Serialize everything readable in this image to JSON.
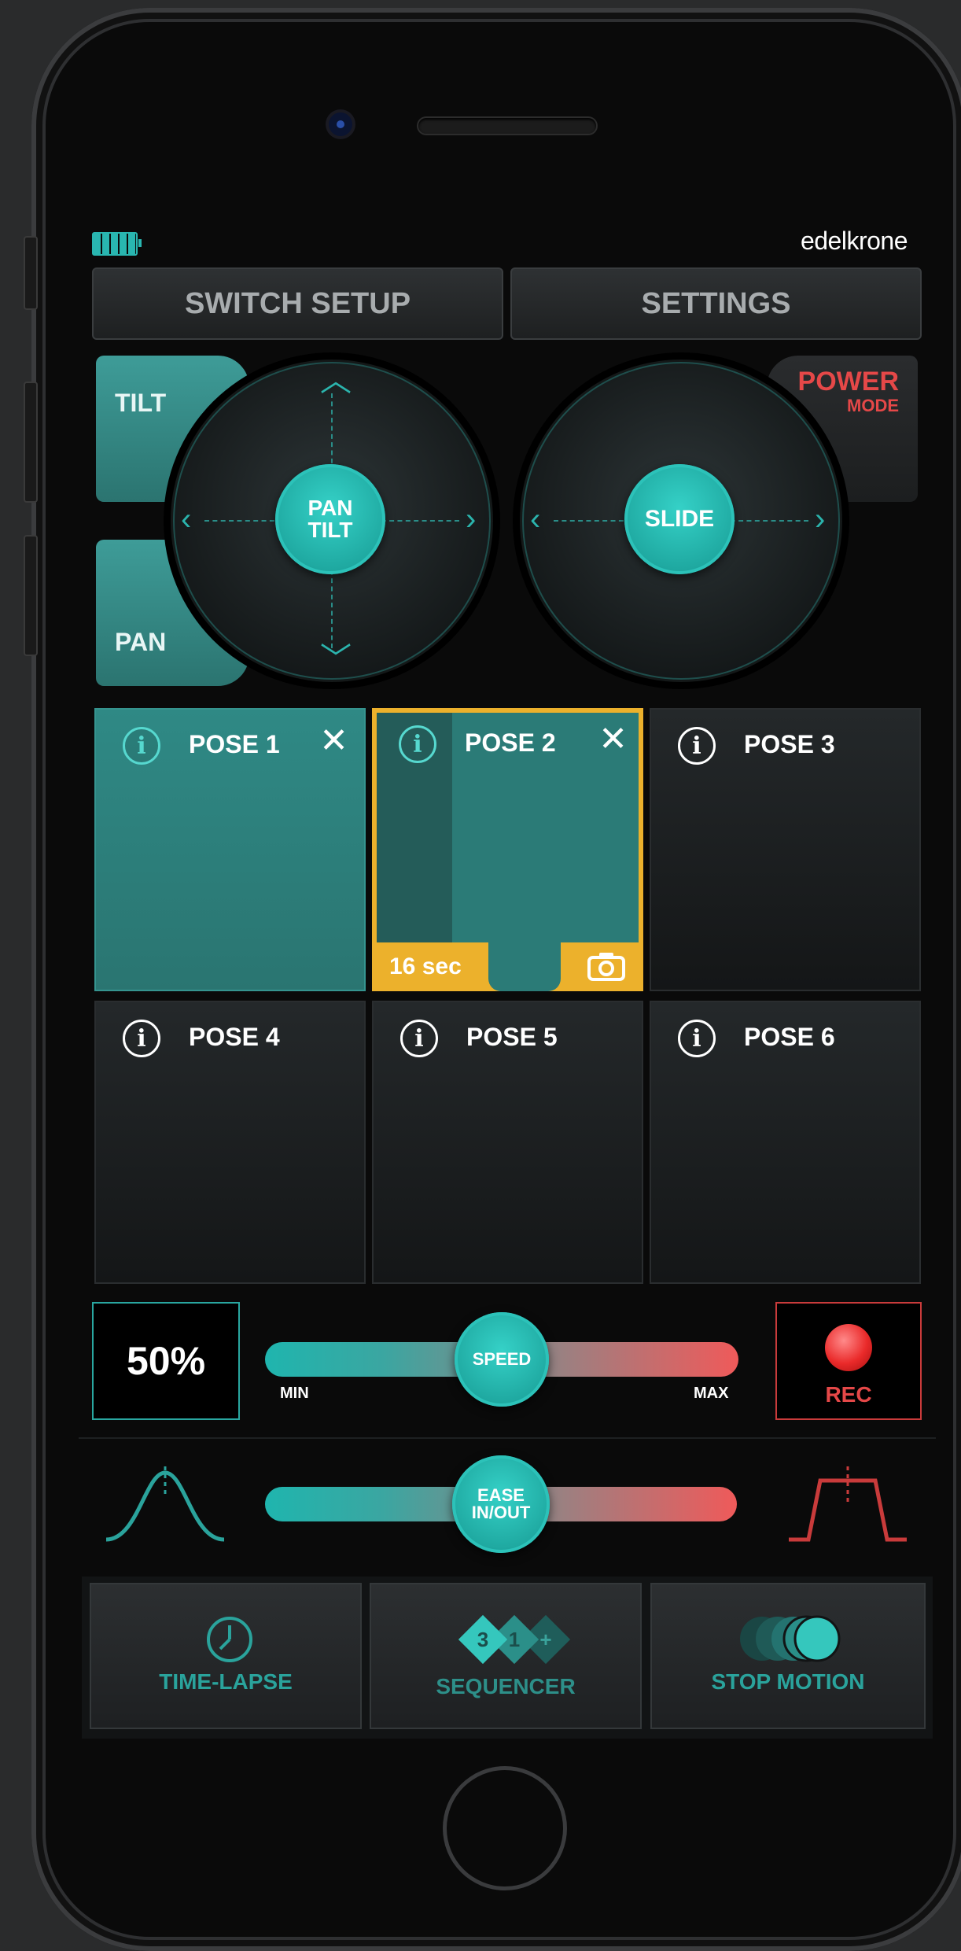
{
  "status": {
    "battery_icon": "battery-full-icon",
    "brand": "edelkrone"
  },
  "top": {
    "switch_setup": "SWITCH SETUP",
    "settings": "SETTINGS"
  },
  "joysticks": {
    "left_tab_top": "TILT",
    "left_tab_bottom": "PAN",
    "left_knob_line1": "PAN",
    "left_knob_line2": "TILT",
    "right_knob": "SLIDE",
    "power_line1": "POWER",
    "power_line2": "MODE"
  },
  "poses": [
    {
      "label": "POSE 1",
      "state": "saved"
    },
    {
      "label": "POSE 2",
      "state": "selected",
      "duration": "16 sec"
    },
    {
      "label": "POSE 3",
      "state": "empty"
    },
    {
      "label": "POSE 4",
      "state": "empty"
    },
    {
      "label": "POSE 5",
      "state": "empty"
    },
    {
      "label": "POSE 6",
      "state": "empty"
    }
  ],
  "speed": {
    "percent": "50%",
    "knob": "SPEED",
    "min": "MIN",
    "max": "MAX",
    "level": 0.5
  },
  "rec": {
    "label": "REC"
  },
  "ease": {
    "knob_line1": "EASE",
    "knob_line2": "IN/OUT",
    "level": 0.5
  },
  "modes": {
    "timelapse": "TIME-LAPSE",
    "sequencer": "SEQUENCER",
    "stopmotion": "STOP MOTION",
    "seq_badges": [
      "3",
      "1",
      "+"
    ]
  },
  "colors": {
    "teal": "#1fb5ae",
    "red": "#ef5a5a",
    "yellow": "#ecb12c"
  }
}
